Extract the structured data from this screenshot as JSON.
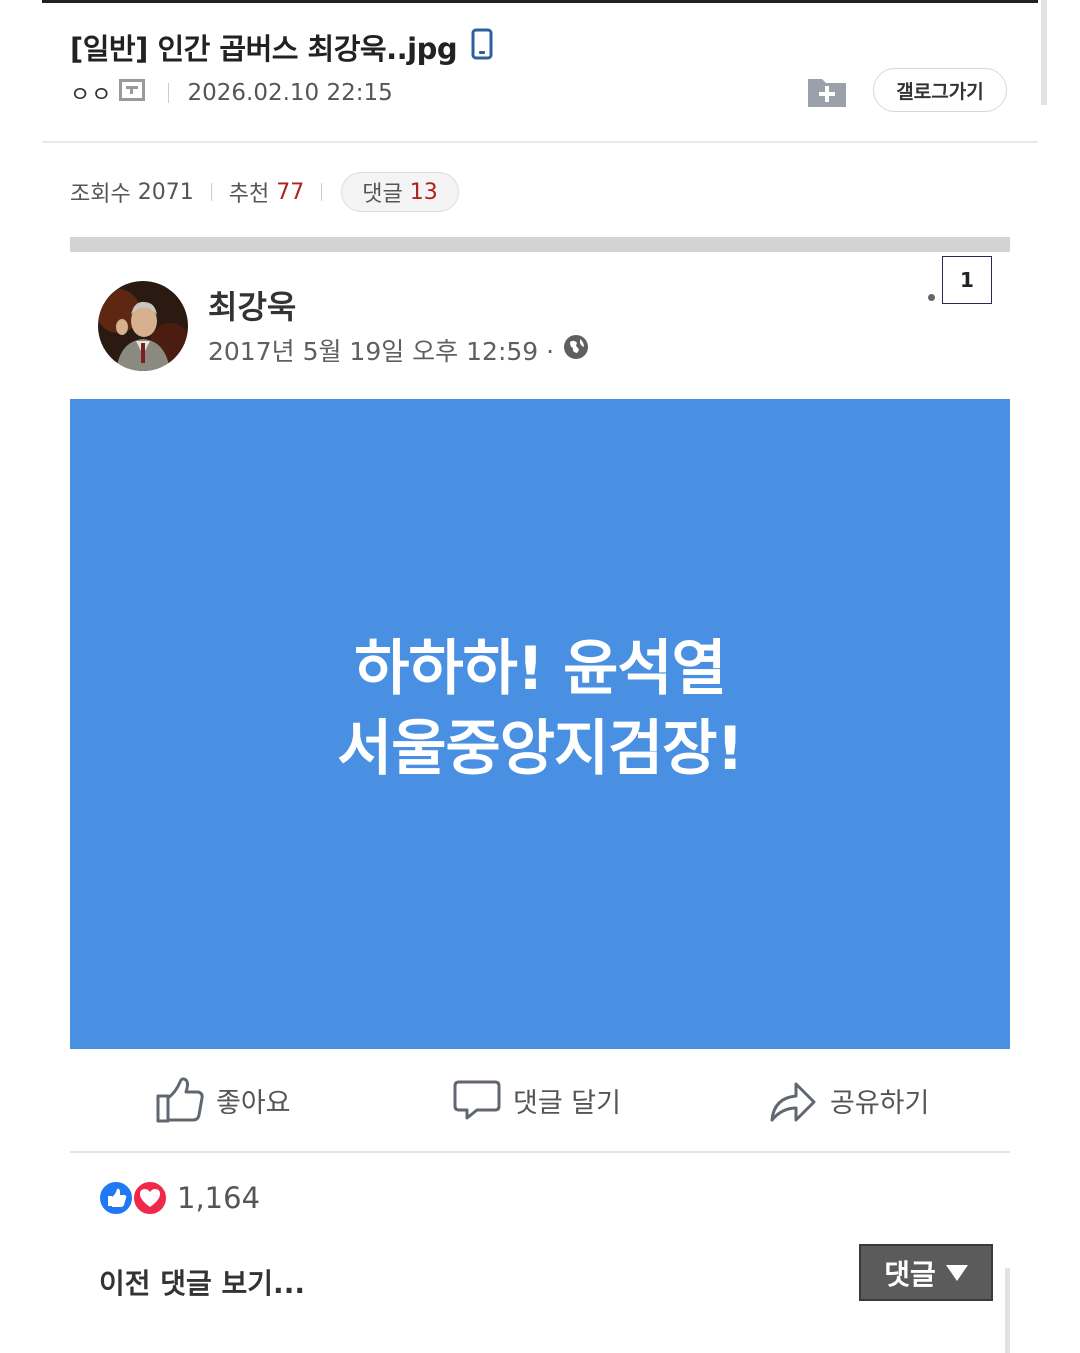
{
  "post": {
    "title": "[일반] 인간 곱버스 최강욱..jpg",
    "author": "ㅇㅇ",
    "date": "2026.02.10 22:15",
    "gallery_button": "갤로그가기"
  },
  "stats": {
    "views_label": "조회수",
    "views": "2071",
    "recommend_label": "추천",
    "recommend": "77",
    "comments_label": "댓글",
    "comments": "13"
  },
  "fb": {
    "name": "최강욱",
    "date": "2017년 5월 19일 오후 12:59 ·",
    "page_number": "1",
    "text_line1": "하하하! 윤석열",
    "text_line2": "서울중앙지검장!",
    "panel_color": "#4a90e2",
    "actions": {
      "like": "좋아요",
      "comment": "댓글 달기",
      "share": "공유하기"
    },
    "reactions_count": "1,164",
    "prev_comments": "이전 댓글 보기..."
  },
  "comment_tab": {
    "label": "댓글"
  },
  "colors": {
    "accent_red": "#b0201f",
    "fb_blue": "#4a90e2"
  }
}
